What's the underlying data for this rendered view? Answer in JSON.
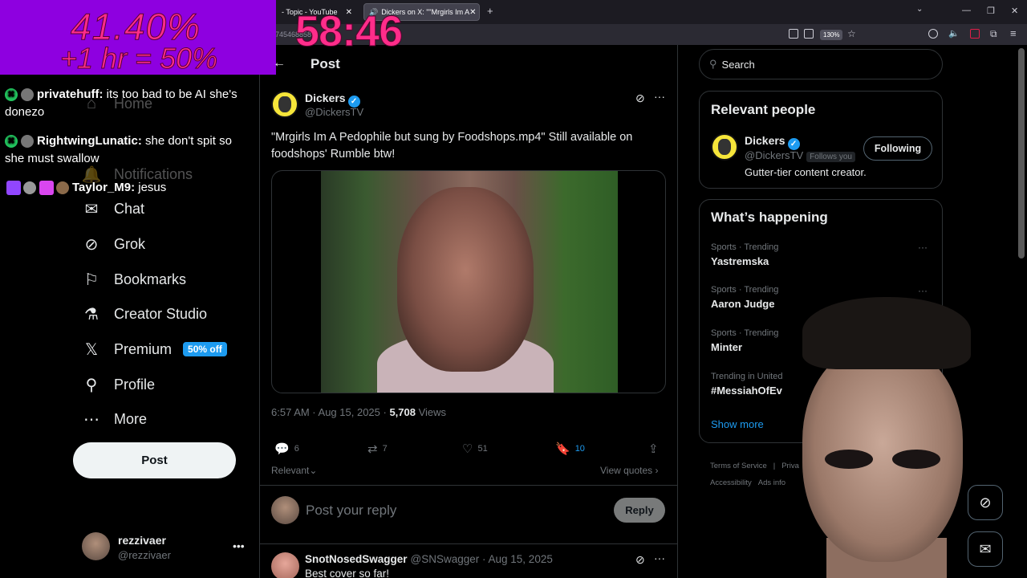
{
  "browser": {
    "tabs": [
      {
        "label": "- Topic - YouTube"
      },
      {
        "label": "Dickers on X: \"\"Mrgirls Im A"
      }
    ],
    "url_fragment": "745468858",
    "zoom": "130%"
  },
  "overlay": {
    "percent": "41.40%",
    "bonus": "+1 hr = 50%",
    "timer": "58:46",
    "chat": [
      {
        "user": "privatehuff:",
        "msg": "its too bad to be AI she's donezo"
      },
      {
        "user": "RightwingLunatic:",
        "msg": "she don't spit so she must swallow"
      },
      {
        "user": "Taylor_M9:",
        "msg": "jesus"
      }
    ]
  },
  "nav": {
    "home": "Home",
    "notifications": "Notifications",
    "chat": "Chat",
    "grok": "Grok",
    "bookmarks": "Bookmarks",
    "creator": "Creator Studio",
    "premium": "Premium",
    "premium_badge": "50% off",
    "profile": "Profile",
    "more": "More",
    "post_button": "Post",
    "me_name": "rezzivaer",
    "me_handle": "@rezzivaer"
  },
  "post": {
    "page_title": "Post",
    "author_name": "Dickers",
    "author_handle": "@DickersTV",
    "text": "\"Mrgirls Im A Pedophile but sung by Foodshops.mp4\" Still available on foodshops' Rumble btw!",
    "time": "6:57 AM · Aug 15, 2025 · ",
    "views_count": "5,708",
    "views_label": " Views",
    "replies": "6",
    "reposts": "7",
    "likes": "51",
    "bookmarks": "10",
    "sort_label": "Relevant",
    "view_quotes": "View quotes",
    "reply_placeholder": "Post your reply",
    "reply_button": "Reply"
  },
  "comment": {
    "name": "SnotNosedSwagger",
    "handle_time": "@SNSwagger · Aug 15, 2025",
    "text": "Best cover so far!"
  },
  "sidebar": {
    "search_placeholder": "Search",
    "relevant_title": "Relevant people",
    "rp_name": "Dickers",
    "rp_handle": "@DickersTV",
    "rp_follows": "Follows you",
    "rp_bio": "Gutter-tier content creator.",
    "following_button": "Following",
    "happening_title": "What’s happening",
    "trends": [
      {
        "category": "Sports · Trending",
        "name": "Yastremska"
      },
      {
        "category": "Sports · Trending",
        "name": "Aaron Judge"
      },
      {
        "category": "Sports · Trending",
        "name": "Minter"
      },
      {
        "category": "Trending in United",
        "name": "#MessiahOfEv"
      }
    ],
    "show_more": "Show more",
    "footer": [
      "Terms of Service",
      "|",
      "Priva",
      "Accessibility",
      "Ads info"
    ]
  },
  "colors": {
    "accent": "#1d9bf0",
    "overlay_bg": "#8e00e0",
    "overlay_text": "#ff2d8a"
  }
}
